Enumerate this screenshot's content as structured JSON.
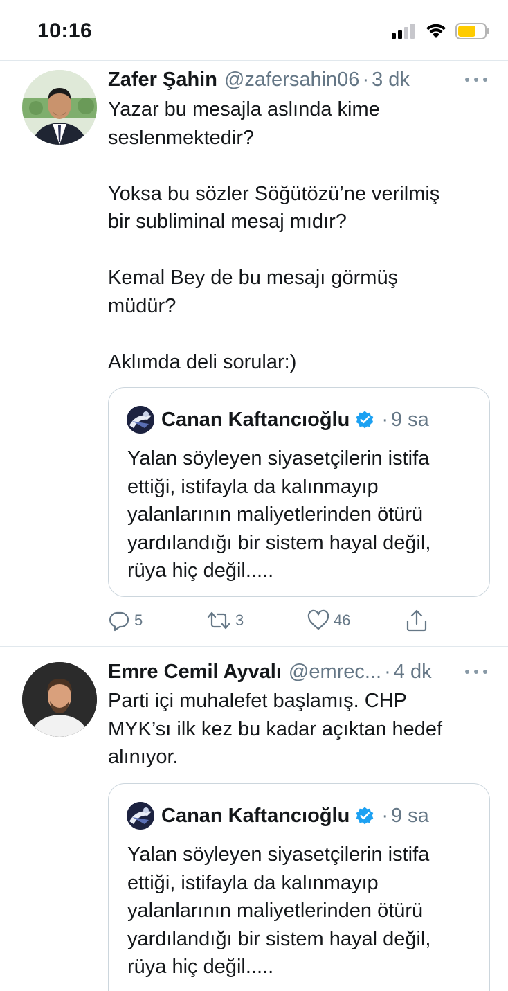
{
  "status_bar": {
    "time": "10:16",
    "icons": [
      "signal-icon",
      "wifi-icon",
      "battery-icon"
    ],
    "battery_color": "#ffcc00"
  },
  "colors": {
    "verified": "#1da1f2",
    "secondary_text": "#657786",
    "border": "#e1e8ed"
  },
  "tweets": [
    {
      "display_name": "Zafer Şahin",
      "handle": "@zafersahin06",
      "separator": "·",
      "time": "3 dk",
      "text": "Yazar bu mesajla aslında kime\nseslenmektedir?\n\nYoksa bu sözler Söğütözü’ne verilmiş\nbir subliminal mesaj mıdır?\n\nKemal Bey de bu mesajı görmüş\nmüdür?\n\nAklımda deli sorular:)",
      "quote": {
        "display_name": "Canan Kaftancıoğlu",
        "separator": "·",
        "time": "9 sa",
        "text": "Yalan söyleyen siyasetçilerin istifa\nettiği, istifayla da kalınmayıp\nyalanlarının maliyetlerinden ötürü\nyardılandığı bir sistem hayal değil,\nrüya hiç değil....."
      },
      "actions": {
        "replies": "5",
        "retweets": "3",
        "likes": "46"
      }
    },
    {
      "display_name": "Emre Cemil Ayvalı",
      "handle": "@emrec...",
      "separator": "·",
      "time": "4 dk",
      "text": "Parti içi muhalefet başlamış. CHP\nMYK’sı ilk kez bu kadar açıktan hedef\nalınıyor.",
      "quote": {
        "display_name": "Canan Kaftancıoğlu",
        "separator": "·",
        "time": "9 sa",
        "text": "Yalan söyleyen siyasetçilerin istifa\nettiği, istifayla da kalınmayıp\nyalanlarının maliyetlerinden ötürü\nyardılandığı bir sistem hayal değil,\nrüya hiç değil....."
      }
    }
  ]
}
